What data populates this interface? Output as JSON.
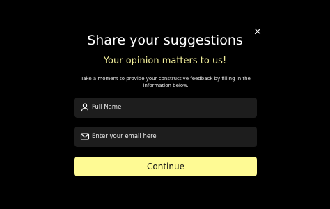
{
  "dialog": {
    "title": "Share your suggestions",
    "subtitle": "Your opinion matters to us!",
    "description": "Take a moment to provide your constructive feedback by filling in the information below."
  },
  "form": {
    "name_field": {
      "placeholder": "Full Name",
      "icon": "user-icon"
    },
    "email_field": {
      "placeholder": "Enter your email here",
      "icon": "envelope-icon"
    },
    "submit_label": "Continue"
  },
  "close": {
    "icon": "close-icon"
  },
  "colors": {
    "background": "#000000",
    "accent": "#fefa94",
    "subtitle": "#f3ef9a",
    "field_background": "#1d1d1d"
  }
}
